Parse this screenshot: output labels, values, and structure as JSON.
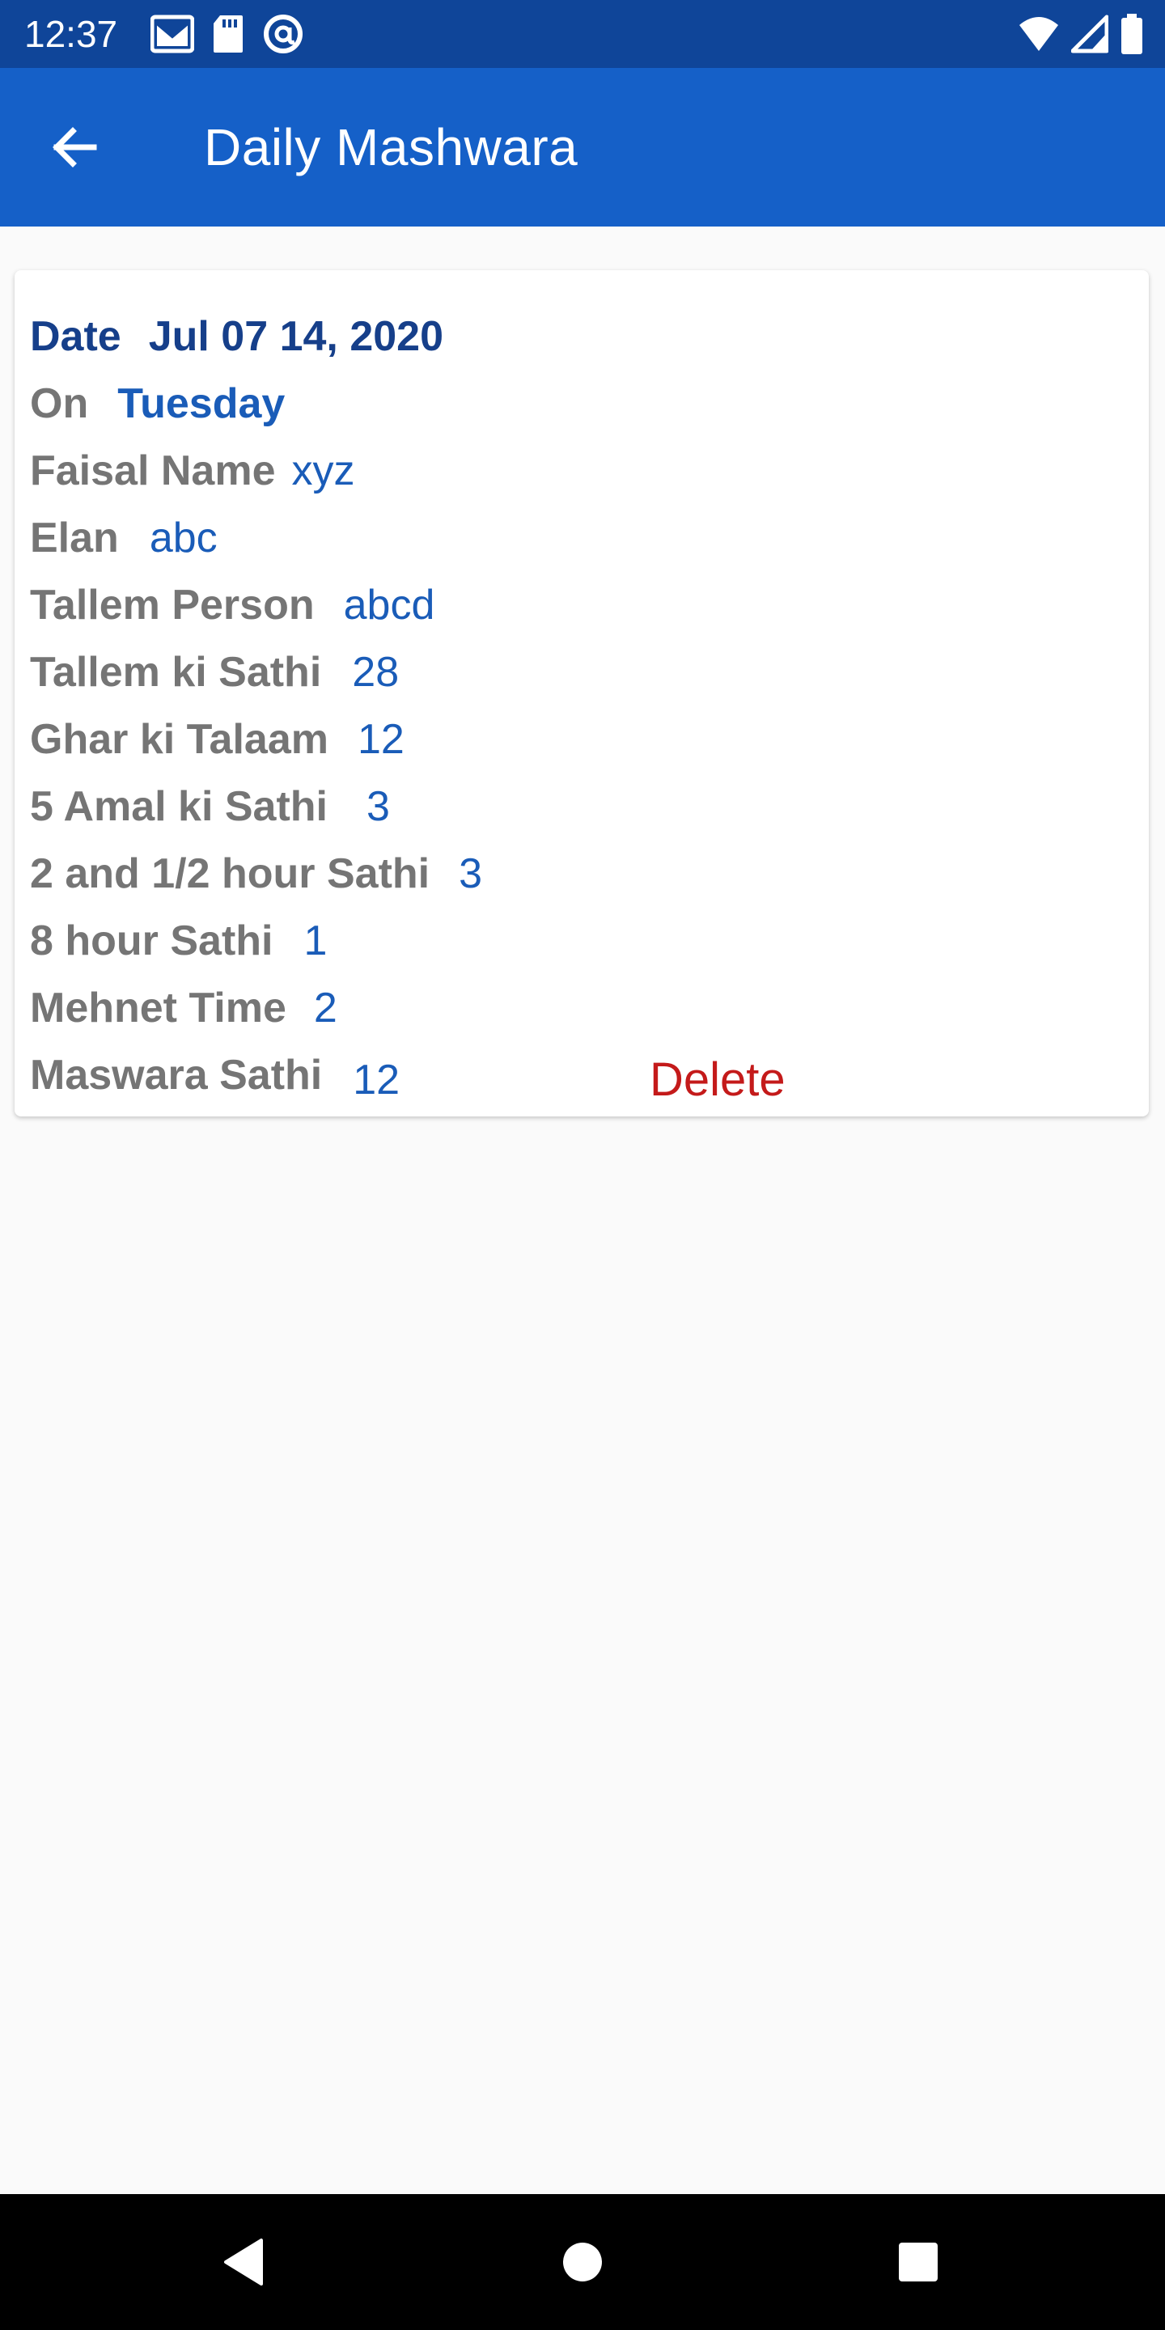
{
  "status_bar": {
    "time": "12:37",
    "left_icons": [
      "gmail-icon",
      "sd-card-icon",
      "at-sign-icon"
    ],
    "right_icons": [
      "wifi-icon",
      "cellular-signal-icon",
      "battery-icon"
    ]
  },
  "app_bar": {
    "back_icon": "arrow-back-icon",
    "title": "Daily Mashwara",
    "background": "#1560c8"
  },
  "record": {
    "date_label": "Date",
    "date_value": "Jul 07 14, 2020",
    "day_label": "On",
    "day_value": "Tuesday",
    "fields": [
      {
        "label": "Faisal Name",
        "value": "xyz"
      },
      {
        "label": "Elan",
        "value": "abc"
      },
      {
        "label": "Tallem Person",
        "value": "abcd"
      },
      {
        "label": "Tallem ki Sathi",
        "value": "28"
      },
      {
        "label": "Ghar ki Talaam",
        "value": "12"
      },
      {
        "label": "5 Amal ki Sathi",
        "value": "3"
      },
      {
        "label": "2 and 1/2 hour Sathi",
        "value": "3"
      },
      {
        "label": "8 hour Sathi",
        "value": "1"
      },
      {
        "label": "Mehnet Time",
        "value": "2"
      },
      {
        "label": "Maswara Sathi",
        "value": "12"
      }
    ],
    "delete_label": "Delete",
    "delete_color": "#c41a1a"
  },
  "nav_bar": {
    "buttons": [
      "back-triangle-icon",
      "home-circle-icon",
      "recents-square-icon"
    ]
  }
}
